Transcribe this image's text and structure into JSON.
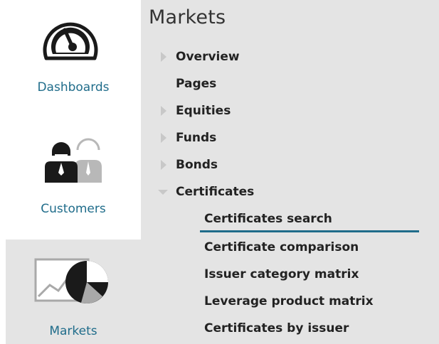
{
  "nav": {
    "dashboards": {
      "label": "Dashboards",
      "icon": "speedometer-icon"
    },
    "customers": {
      "label": "Customers",
      "icon": "customers-icon"
    },
    "markets": {
      "label": "Markets",
      "icon": "markets-chart-icon"
    }
  },
  "panel": {
    "title": "Markets",
    "items": [
      {
        "label": "Overview",
        "arrow": "collapsed"
      },
      {
        "label": "Pages",
        "arrow": "none"
      },
      {
        "label": "Equities",
        "arrow": "collapsed"
      },
      {
        "label": "Funds",
        "arrow": "collapsed"
      },
      {
        "label": "Bonds",
        "arrow": "collapsed"
      },
      {
        "label": "Certificates",
        "arrow": "expanded"
      }
    ],
    "subitems": [
      {
        "label": "Certificates search",
        "active": true
      },
      {
        "label": "Certificate comparison"
      },
      {
        "label": "Issuer category matrix"
      },
      {
        "label": "Leverage product matrix"
      },
      {
        "label": "Certificates by issuer"
      }
    ]
  },
  "colors": {
    "accent": "#1f6c8a",
    "panel_bg": "#e4e4e4",
    "arrow": "#c8c8c8"
  }
}
